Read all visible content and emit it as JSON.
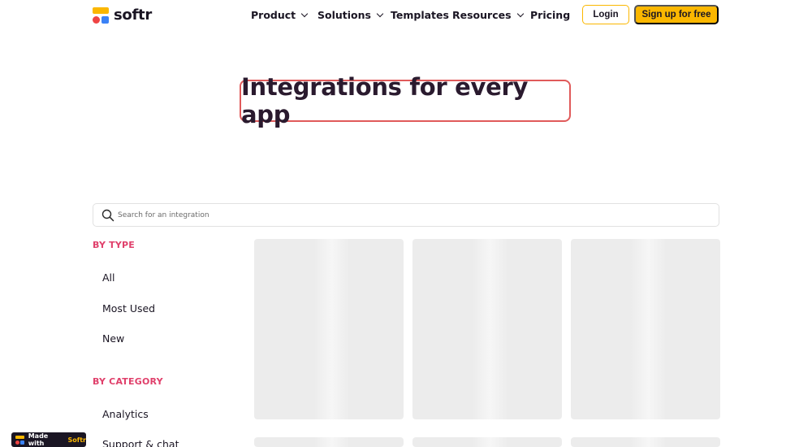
{
  "header": {
    "logo_text": "softr",
    "nav": [
      {
        "label": "Product",
        "has_dropdown": true
      },
      {
        "label": "Solutions",
        "has_dropdown": true
      },
      {
        "label": "Templates",
        "has_dropdown": false
      },
      {
        "label": "Resources",
        "has_dropdown": true
      },
      {
        "label": "Pricing",
        "has_dropdown": false
      }
    ],
    "login_label": "Login",
    "signup_label": "Sign up for free"
  },
  "hero": {
    "title": "Integrations for every app"
  },
  "search": {
    "placeholder": "Search for an integration",
    "value": ""
  },
  "sidebar": {
    "type_heading": "BY TYPE",
    "type_items": [
      "All",
      "Most Used",
      "New"
    ],
    "category_heading": "BY CATEGORY",
    "category_items": [
      "Analytics",
      "Support & chat"
    ]
  },
  "badge": {
    "prefix": "Made with",
    "brand": "Softr"
  },
  "colors": {
    "accent_yellow": "#fbb700",
    "heading_pink": "#e0406b",
    "hero_border": "#e05a5a",
    "logo_red": "#ef4444",
    "logo_blue": "#3b82f6",
    "text_dark": "#1a1523"
  },
  "icons": {
    "logo": "softr-logo-icon",
    "search": "search-icon",
    "dropdown": "chevron-down-icon"
  }
}
